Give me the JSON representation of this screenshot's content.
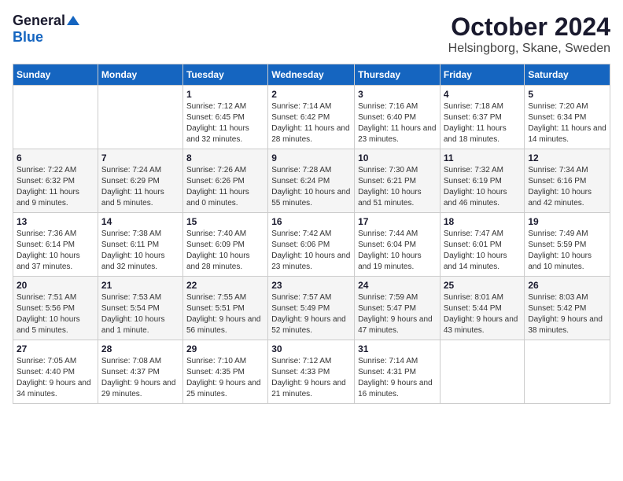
{
  "logo": {
    "general": "General",
    "blue": "Blue"
  },
  "title": "October 2024",
  "location": "Helsingborg, Skane, Sweden",
  "days_of_week": [
    "Sunday",
    "Monday",
    "Tuesday",
    "Wednesday",
    "Thursday",
    "Friday",
    "Saturday"
  ],
  "weeks": [
    [
      {
        "day": "",
        "sunrise": "",
        "sunset": "",
        "daylight": ""
      },
      {
        "day": "",
        "sunrise": "",
        "sunset": "",
        "daylight": ""
      },
      {
        "day": "1",
        "sunrise": "Sunrise: 7:12 AM",
        "sunset": "Sunset: 6:45 PM",
        "daylight": "Daylight: 11 hours and 32 minutes."
      },
      {
        "day": "2",
        "sunrise": "Sunrise: 7:14 AM",
        "sunset": "Sunset: 6:42 PM",
        "daylight": "Daylight: 11 hours and 28 minutes."
      },
      {
        "day": "3",
        "sunrise": "Sunrise: 7:16 AM",
        "sunset": "Sunset: 6:40 PM",
        "daylight": "Daylight: 11 hours and 23 minutes."
      },
      {
        "day": "4",
        "sunrise": "Sunrise: 7:18 AM",
        "sunset": "Sunset: 6:37 PM",
        "daylight": "Daylight: 11 hours and 18 minutes."
      },
      {
        "day": "5",
        "sunrise": "Sunrise: 7:20 AM",
        "sunset": "Sunset: 6:34 PM",
        "daylight": "Daylight: 11 hours and 14 minutes."
      }
    ],
    [
      {
        "day": "6",
        "sunrise": "Sunrise: 7:22 AM",
        "sunset": "Sunset: 6:32 PM",
        "daylight": "Daylight: 11 hours and 9 minutes."
      },
      {
        "day": "7",
        "sunrise": "Sunrise: 7:24 AM",
        "sunset": "Sunset: 6:29 PM",
        "daylight": "Daylight: 11 hours and 5 minutes."
      },
      {
        "day": "8",
        "sunrise": "Sunrise: 7:26 AM",
        "sunset": "Sunset: 6:26 PM",
        "daylight": "Daylight: 11 hours and 0 minutes."
      },
      {
        "day": "9",
        "sunrise": "Sunrise: 7:28 AM",
        "sunset": "Sunset: 6:24 PM",
        "daylight": "Daylight: 10 hours and 55 minutes."
      },
      {
        "day": "10",
        "sunrise": "Sunrise: 7:30 AM",
        "sunset": "Sunset: 6:21 PM",
        "daylight": "Daylight: 10 hours and 51 minutes."
      },
      {
        "day": "11",
        "sunrise": "Sunrise: 7:32 AM",
        "sunset": "Sunset: 6:19 PM",
        "daylight": "Daylight: 10 hours and 46 minutes."
      },
      {
        "day": "12",
        "sunrise": "Sunrise: 7:34 AM",
        "sunset": "Sunset: 6:16 PM",
        "daylight": "Daylight: 10 hours and 42 minutes."
      }
    ],
    [
      {
        "day": "13",
        "sunrise": "Sunrise: 7:36 AM",
        "sunset": "Sunset: 6:14 PM",
        "daylight": "Daylight: 10 hours and 37 minutes."
      },
      {
        "day": "14",
        "sunrise": "Sunrise: 7:38 AM",
        "sunset": "Sunset: 6:11 PM",
        "daylight": "Daylight: 10 hours and 32 minutes."
      },
      {
        "day": "15",
        "sunrise": "Sunrise: 7:40 AM",
        "sunset": "Sunset: 6:09 PM",
        "daylight": "Daylight: 10 hours and 28 minutes."
      },
      {
        "day": "16",
        "sunrise": "Sunrise: 7:42 AM",
        "sunset": "Sunset: 6:06 PM",
        "daylight": "Daylight: 10 hours and 23 minutes."
      },
      {
        "day": "17",
        "sunrise": "Sunrise: 7:44 AM",
        "sunset": "Sunset: 6:04 PM",
        "daylight": "Daylight: 10 hours and 19 minutes."
      },
      {
        "day": "18",
        "sunrise": "Sunrise: 7:47 AM",
        "sunset": "Sunset: 6:01 PM",
        "daylight": "Daylight: 10 hours and 14 minutes."
      },
      {
        "day": "19",
        "sunrise": "Sunrise: 7:49 AM",
        "sunset": "Sunset: 5:59 PM",
        "daylight": "Daylight: 10 hours and 10 minutes."
      }
    ],
    [
      {
        "day": "20",
        "sunrise": "Sunrise: 7:51 AM",
        "sunset": "Sunset: 5:56 PM",
        "daylight": "Daylight: 10 hours and 5 minutes."
      },
      {
        "day": "21",
        "sunrise": "Sunrise: 7:53 AM",
        "sunset": "Sunset: 5:54 PM",
        "daylight": "Daylight: 10 hours and 1 minute."
      },
      {
        "day": "22",
        "sunrise": "Sunrise: 7:55 AM",
        "sunset": "Sunset: 5:51 PM",
        "daylight": "Daylight: 9 hours and 56 minutes."
      },
      {
        "day": "23",
        "sunrise": "Sunrise: 7:57 AM",
        "sunset": "Sunset: 5:49 PM",
        "daylight": "Daylight: 9 hours and 52 minutes."
      },
      {
        "day": "24",
        "sunrise": "Sunrise: 7:59 AM",
        "sunset": "Sunset: 5:47 PM",
        "daylight": "Daylight: 9 hours and 47 minutes."
      },
      {
        "day": "25",
        "sunrise": "Sunrise: 8:01 AM",
        "sunset": "Sunset: 5:44 PM",
        "daylight": "Daylight: 9 hours and 43 minutes."
      },
      {
        "day": "26",
        "sunrise": "Sunrise: 8:03 AM",
        "sunset": "Sunset: 5:42 PM",
        "daylight": "Daylight: 9 hours and 38 minutes."
      }
    ],
    [
      {
        "day": "27",
        "sunrise": "Sunrise: 7:05 AM",
        "sunset": "Sunset: 4:40 PM",
        "daylight": "Daylight: 9 hours and 34 minutes."
      },
      {
        "day": "28",
        "sunrise": "Sunrise: 7:08 AM",
        "sunset": "Sunset: 4:37 PM",
        "daylight": "Daylight: 9 hours and 29 minutes."
      },
      {
        "day": "29",
        "sunrise": "Sunrise: 7:10 AM",
        "sunset": "Sunset: 4:35 PM",
        "daylight": "Daylight: 9 hours and 25 minutes."
      },
      {
        "day": "30",
        "sunrise": "Sunrise: 7:12 AM",
        "sunset": "Sunset: 4:33 PM",
        "daylight": "Daylight: 9 hours and 21 minutes."
      },
      {
        "day": "31",
        "sunrise": "Sunrise: 7:14 AM",
        "sunset": "Sunset: 4:31 PM",
        "daylight": "Daylight: 9 hours and 16 minutes."
      },
      {
        "day": "",
        "sunrise": "",
        "sunset": "",
        "daylight": ""
      },
      {
        "day": "",
        "sunrise": "",
        "sunset": "",
        "daylight": ""
      }
    ]
  ]
}
